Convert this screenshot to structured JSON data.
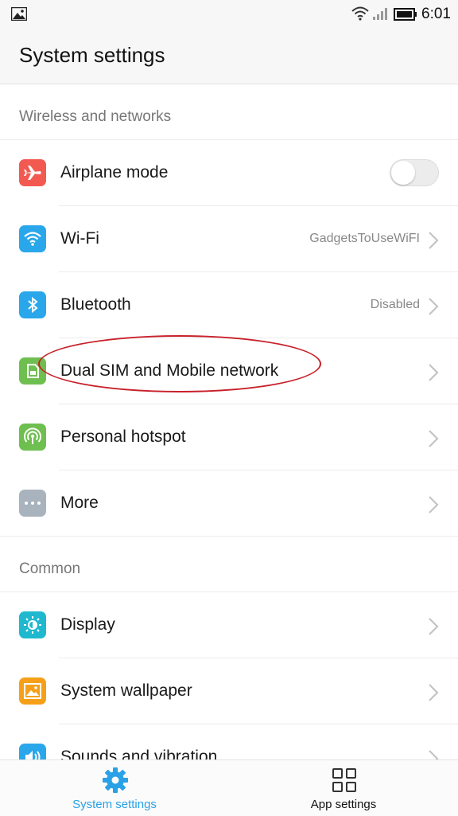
{
  "status_bar": {
    "time": "6:01"
  },
  "header": {
    "title": "System settings"
  },
  "sections": [
    {
      "title": "Wireless and networks",
      "items": [
        {
          "label": "Airplane mode",
          "icon": "airplane-icon",
          "color": "#f25a51",
          "control": "toggle",
          "toggle_on": false
        },
        {
          "label": "Wi-Fi",
          "value": "GadgetsToUseWiFI",
          "icon": "wifi-icon",
          "color": "#2aa7ea"
        },
        {
          "label": "Bluetooth",
          "value": "Disabled",
          "icon": "bluetooth-icon",
          "color": "#2aa7ea"
        },
        {
          "label": "Dual SIM and Mobile network",
          "icon": "sim-icon",
          "color": "#6ebf4f"
        },
        {
          "label": "Personal hotspot",
          "icon": "hotspot-icon",
          "color": "#6ebf4f"
        },
        {
          "label": "More",
          "icon": "more-icon",
          "color": "#a9b3bd"
        }
      ]
    },
    {
      "title": "Common",
      "items": [
        {
          "label": "Display",
          "icon": "brightness-icon",
          "color": "#1fb8cf"
        },
        {
          "label": "System wallpaper",
          "icon": "wallpaper-icon",
          "color": "#f6a019"
        },
        {
          "label": "Sounds and vibration",
          "icon": "sound-icon",
          "color": "#2aa7ea"
        }
      ]
    }
  ],
  "bottom_nav": [
    {
      "label": "System settings",
      "icon": "gear-icon",
      "active": true
    },
    {
      "label": "App settings",
      "icon": "grid-icon",
      "active": false
    }
  ],
  "accent_color": "#2aa1e6",
  "annotation_color": "#c8202a"
}
